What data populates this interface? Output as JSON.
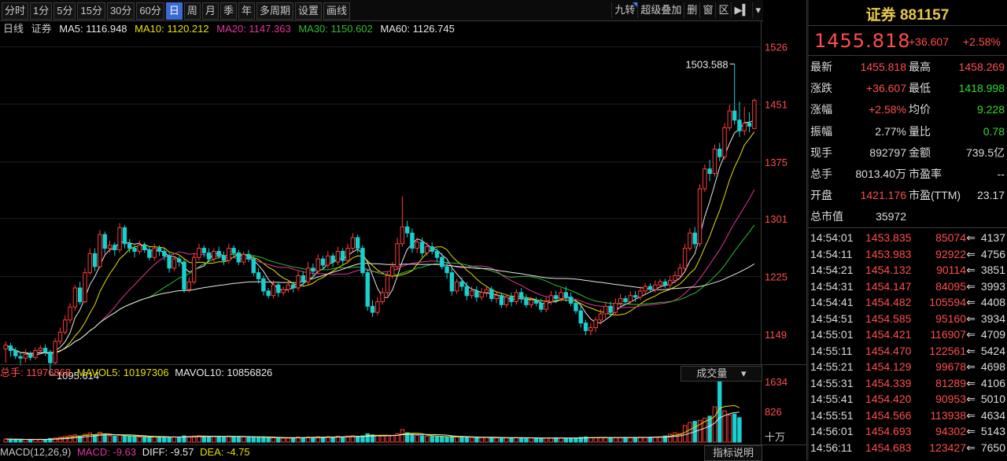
{
  "toolbar": {
    "tabs": [
      "分时",
      "1分",
      "5分",
      "15分",
      "30分",
      "60分",
      "日",
      "周",
      "月",
      "季",
      "年",
      "多周期",
      "设置",
      "画线"
    ],
    "active_tab": "日",
    "right_tools": [
      "九转",
      "超级叠加",
      "删",
      "窗",
      "区"
    ],
    "more_icon": "triangle-down",
    "arrow_icon": "arrow-right-bar"
  },
  "ma_line": {
    "period": "日线",
    "name": "证券",
    "ma5": "MA5: 1116.948",
    "ma10": "MA10: 1120.212",
    "ma20": "MA20: 1147.363",
    "ma30": "MA30: 1150.602",
    "ma60": "MA60: 1126.745"
  },
  "colors": {
    "up": "#ff3b3b",
    "down": "#18d0d0",
    "ma5": "#e8e8e8",
    "ma10": "#e8e000",
    "ma20": "#e0359a",
    "ma30": "#2fbd2f",
    "ma60": "#e8e8e8"
  },
  "price_axis": {
    "labels": [
      "1526",
      "1451",
      "1375",
      "1301",
      "1225",
      "1149"
    ]
  },
  "annotations": {
    "high": "1503.588",
    "low": "1095.614"
  },
  "volume": {
    "total": "总手: 11976868",
    "mavol5": "MAVOL5: 10197306",
    "mavol10": "MAVOL10: 10856826",
    "select": "成交量",
    "axis_labels": [
      "1634",
      "826",
      "十万"
    ]
  },
  "macd": {
    "label": "MACD(12,26,9)",
    "macd": "MACD: -9.63",
    "diff": "DIFF: -9.57",
    "dea": "DEA: -4.75",
    "indicator_button": "指标说明"
  },
  "panel": {
    "title": "证券 881157",
    "price": "1455.818",
    "change": "+36.607",
    "change_pct": "+2.58%",
    "rows": [
      {
        "l1": "最新",
        "v1": "1455.818",
        "c1": "red",
        "l2": "最高",
        "v2": "1458.269",
        "c2": "red"
      },
      {
        "l1": "涨跌",
        "v1": "+36.607",
        "c1": "red",
        "l2": "最低",
        "v2": "1418.998",
        "c2": "green"
      },
      {
        "l1": "涨幅",
        "v1": "+2.58%",
        "c1": "red",
        "l2": "均价",
        "v2": "9.228",
        "c2": "green"
      },
      {
        "l1": "振幅",
        "v1": "2.77%",
        "c1": "white",
        "l2": "量比",
        "v2": "0.78",
        "c2": "green"
      },
      {
        "l1": "现手",
        "v1": "892797",
        "c1": "white",
        "l2": "金额",
        "v2": "739.5亿",
        "c2": "white"
      },
      {
        "l1": "总手",
        "v1": "8013.40万",
        "c1": "white",
        "l2": "市盈率",
        "v2": "--",
        "c2": "white"
      },
      {
        "l1": "开盘",
        "v1": "1421.176",
        "c1": "red",
        "l2": "市盈(TTM)",
        "v2": "23.17",
        "c2": "white"
      },
      {
        "l1": "总市值",
        "v1": "35972",
        "c1": "white",
        "l2": "",
        "v2": "",
        "c2": "white"
      }
    ],
    "ticks": [
      {
        "time": "14:54:01",
        "price": "1453.835",
        "vol": "85074",
        "amt": "4137"
      },
      {
        "time": "14:54:11",
        "price": "1453.983",
        "vol": "92922",
        "amt": "4756"
      },
      {
        "time": "14:54:21",
        "price": "1454.132",
        "vol": "90114",
        "amt": "3851"
      },
      {
        "time": "14:54:31",
        "price": "1454.147",
        "vol": "84095",
        "amt": "3993"
      },
      {
        "time": "14:54:41",
        "price": "1454.482",
        "vol": "105594",
        "amt": "4408"
      },
      {
        "time": "14:54:51",
        "price": "1454.585",
        "vol": "95160",
        "amt": "3934"
      },
      {
        "time": "14:55:01",
        "price": "1454.421",
        "vol": "116907",
        "amt": "4709"
      },
      {
        "time": "14:55:11",
        "price": "1454.470",
        "vol": "122561",
        "amt": "5424"
      },
      {
        "time": "14:55:21",
        "price": "1454.129",
        "vol": "99678",
        "amt": "4698"
      },
      {
        "time": "14:55:31",
        "price": "1454.339",
        "vol": "81289",
        "amt": "4106"
      },
      {
        "time": "14:55:41",
        "price": "1454.420",
        "vol": "90953",
        "amt": "5010"
      },
      {
        "time": "14:55:51",
        "price": "1454.566",
        "vol": "113938",
        "amt": "4634"
      },
      {
        "time": "14:56:01",
        "price": "1454.693",
        "vol": "94302",
        "amt": "5143"
      },
      {
        "time": "14:56:11",
        "price": "1454.683",
        "vol": "123427",
        "amt": "7650"
      }
    ]
  },
  "chart_data": {
    "type": "candlestick",
    "y_range": [
      1110,
      1540
    ],
    "candles": [
      [
        1130,
        1135,
        1112,
        1140
      ],
      [
        1134,
        1128,
        1120,
        1138
      ],
      [
        1128,
        1121,
        1117,
        1132
      ],
      [
        1120,
        1118,
        1108,
        1126
      ],
      [
        1118,
        1123,
        1112,
        1130
      ],
      [
        1123,
        1119,
        1115,
        1127
      ],
      [
        1119,
        1128,
        1116,
        1132
      ],
      [
        1128,
        1131,
        1124,
        1135
      ],
      [
        1131,
        1126,
        1121,
        1136
      ],
      [
        1126,
        1112,
        1095.614,
        1129
      ],
      [
        1112,
        1140,
        1110,
        1144
      ],
      [
        1140,
        1152,
        1136,
        1158
      ],
      [
        1152,
        1168,
        1149,
        1174
      ],
      [
        1168,
        1185,
        1164,
        1190
      ],
      [
        1185,
        1210,
        1180,
        1214
      ],
      [
        1210,
        1192,
        1188,
        1218
      ],
      [
        1192,
        1230,
        1190,
        1236
      ],
      [
        1230,
        1255,
        1227,
        1262
      ],
      [
        1255,
        1238,
        1232,
        1262
      ],
      [
        1238,
        1280,
        1236,
        1286
      ],
      [
        1280,
        1262,
        1255,
        1284
      ],
      [
        1262,
        1266,
        1256,
        1272
      ],
      [
        1266,
        1260,
        1252,
        1270
      ],
      [
        1260,
        1289,
        1256,
        1295
      ],
      [
        1289,
        1268,
        1262,
        1292
      ],
      [
        1268,
        1262,
        1256,
        1274
      ],
      [
        1262,
        1258,
        1250,
        1266
      ],
      [
        1258,
        1266,
        1254,
        1272
      ],
      [
        1266,
        1260,
        1256,
        1270
      ],
      [
        1260,
        1250,
        1246,
        1264
      ],
      [
        1250,
        1262,
        1246,
        1268
      ],
      [
        1262,
        1258,
        1252,
        1266
      ],
      [
        1258,
        1252,
        1246,
        1262
      ],
      [
        1252,
        1236,
        1230,
        1256
      ],
      [
        1236,
        1248,
        1232,
        1252
      ],
      [
        1248,
        1244,
        1238,
        1252
      ],
      [
        1244,
        1208,
        1204,
        1248
      ],
      [
        1208,
        1218,
        1204,
        1224
      ],
      [
        1218,
        1250,
        1215,
        1256
      ],
      [
        1250,
        1262,
        1246,
        1268
      ],
      [
        1262,
        1256,
        1250,
        1266
      ],
      [
        1256,
        1248,
        1244,
        1262
      ],
      [
        1248,
        1258,
        1244,
        1262
      ],
      [
        1258,
        1252,
        1248,
        1264
      ],
      [
        1252,
        1246,
        1240,
        1258
      ],
      [
        1246,
        1262,
        1242,
        1268
      ],
      [
        1262,
        1256,
        1250,
        1266
      ],
      [
        1256,
        1244,
        1240,
        1260
      ],
      [
        1244,
        1254,
        1240,
        1258
      ],
      [
        1254,
        1248,
        1244,
        1260
      ],
      [
        1248,
        1230,
        1226,
        1252
      ],
      [
        1230,
        1222,
        1216,
        1236
      ],
      [
        1222,
        1206,
        1200,
        1226
      ],
      [
        1206,
        1200,
        1196,
        1210
      ],
      [
        1200,
        1214,
        1196,
        1220
      ],
      [
        1214,
        1204,
        1198,
        1218
      ],
      [
        1204,
        1208,
        1200,
        1212
      ],
      [
        1208,
        1214,
        1204,
        1220
      ],
      [
        1214,
        1210,
        1204,
        1218
      ],
      [
        1210,
        1226,
        1206,
        1232
      ],
      [
        1226,
        1218,
        1212,
        1232
      ],
      [
        1218,
        1236,
        1214,
        1244
      ],
      [
        1236,
        1232,
        1226,
        1242
      ],
      [
        1232,
        1248,
        1228,
        1254
      ],
      [
        1248,
        1240,
        1234,
        1252
      ],
      [
        1240,
        1252,
        1236,
        1258
      ],
      [
        1252,
        1244,
        1238,
        1256
      ],
      [
        1244,
        1258,
        1240,
        1264
      ],
      [
        1258,
        1246,
        1240,
        1262
      ],
      [
        1246,
        1262,
        1242,
        1268
      ],
      [
        1262,
        1276,
        1258,
        1282
      ],
      [
        1276,
        1262,
        1256,
        1280
      ],
      [
        1262,
        1230,
        1226,
        1266
      ],
      [
        1230,
        1186,
        1180,
        1234
      ],
      [
        1186,
        1178,
        1172,
        1194
      ],
      [
        1178,
        1192,
        1174,
        1198
      ],
      [
        1192,
        1204,
        1188,
        1210
      ],
      [
        1204,
        1226,
        1200,
        1232
      ],
      [
        1226,
        1238,
        1222,
        1244
      ],
      [
        1238,
        1268,
        1234,
        1276
      ],
      [
        1268,
        1290,
        1264,
        1330
      ],
      [
        1290,
        1282,
        1276,
        1298
      ],
      [
        1282,
        1262,
        1256,
        1288
      ],
      [
        1262,
        1270,
        1256,
        1276
      ],
      [
        1270,
        1256,
        1250,
        1276
      ],
      [
        1256,
        1264,
        1252,
        1270
      ],
      [
        1264,
        1258,
        1254,
        1270
      ],
      [
        1258,
        1250,
        1244,
        1262
      ],
      [
        1250,
        1238,
        1234,
        1256
      ],
      [
        1238,
        1230,
        1222,
        1244
      ],
      [
        1230,
        1206,
        1200,
        1236
      ],
      [
        1206,
        1218,
        1202,
        1222
      ],
      [
        1218,
        1212,
        1206,
        1224
      ],
      [
        1212,
        1200,
        1194,
        1218
      ],
      [
        1200,
        1206,
        1196,
        1212
      ],
      [
        1206,
        1198,
        1192,
        1212
      ],
      [
        1198,
        1204,
        1194,
        1210
      ],
      [
        1204,
        1208,
        1198,
        1212
      ],
      [
        1208,
        1196,
        1192,
        1212
      ],
      [
        1196,
        1200,
        1190,
        1204
      ],
      [
        1200,
        1188,
        1184,
        1204
      ],
      [
        1188,
        1198,
        1184,
        1202
      ],
      [
        1198,
        1192,
        1186,
        1204
      ],
      [
        1192,
        1204,
        1188,
        1208
      ],
      [
        1204,
        1196,
        1190,
        1210
      ],
      [
        1196,
        1188,
        1184,
        1202
      ],
      [
        1188,
        1194,
        1184,
        1198
      ],
      [
        1194,
        1190,
        1186,
        1198
      ],
      [
        1190,
        1182,
        1178,
        1196
      ],
      [
        1182,
        1192,
        1178,
        1198
      ],
      [
        1192,
        1200,
        1188,
        1206
      ],
      [
        1200,
        1196,
        1190,
        1206
      ],
      [
        1196,
        1204,
        1192,
        1210
      ],
      [
        1204,
        1198,
        1192,
        1212
      ],
      [
        1198,
        1190,
        1186,
        1204
      ],
      [
        1190,
        1180,
        1176,
        1194
      ],
      [
        1180,
        1164,
        1158,
        1186
      ],
      [
        1164,
        1154,
        1148,
        1168
      ],
      [
        1154,
        1158,
        1148,
        1164
      ],
      [
        1158,
        1168,
        1152,
        1172
      ],
      [
        1168,
        1176,
        1162,
        1182
      ],
      [
        1176,
        1186,
        1170,
        1192
      ],
      [
        1186,
        1178,
        1172,
        1192
      ],
      [
        1178,
        1190,
        1174,
        1196
      ],
      [
        1190,
        1196,
        1186,
        1202
      ],
      [
        1196,
        1192,
        1188,
        1200
      ],
      [
        1192,
        1200,
        1188,
        1206
      ],
      [
        1200,
        1198,
        1192,
        1206
      ],
      [
        1198,
        1206,
        1194,
        1212
      ],
      [
        1206,
        1212,
        1202,
        1216
      ],
      [
        1212,
        1208,
        1204,
        1216
      ],
      [
        1208,
        1214,
        1204,
        1220
      ],
      [
        1214,
        1218,
        1210,
        1222
      ],
      [
        1218,
        1214,
        1210,
        1222
      ],
      [
        1214,
        1220,
        1210,
        1226
      ],
      [
        1220,
        1226,
        1216,
        1232
      ],
      [
        1226,
        1236,
        1222,
        1242
      ],
      [
        1236,
        1262,
        1232,
        1268
      ],
      [
        1262,
        1282,
        1258,
        1288
      ],
      [
        1282,
        1268,
        1262,
        1290
      ],
      [
        1268,
        1340,
        1264,
        1346
      ],
      [
        1340,
        1366,
        1336,
        1372
      ],
      [
        1366,
        1360,
        1350,
        1378
      ],
      [
        1360,
        1392,
        1356,
        1398
      ],
      [
        1392,
        1382,
        1376,
        1400
      ],
      [
        1382,
        1420,
        1378,
        1426
      ],
      [
        1420,
        1442,
        1416,
        1450
      ],
      [
        1442,
        1430,
        1424,
        1503.588
      ],
      [
        1430,
        1416,
        1408,
        1454
      ],
      [
        1416,
        1426,
        1410,
        1448
      ],
      [
        1426,
        1422,
        1414,
        1440
      ],
      [
        1419,
        1455.818,
        1418.998,
        1458.269
      ]
    ],
    "volume": [
      30,
      28,
      26,
      24,
      26,
      25,
      27,
      28,
      26,
      35,
      40,
      48,
      55,
      62,
      70,
      58,
      75,
      88,
      72,
      95,
      70,
      60,
      58,
      66,
      60,
      55,
      52,
      50,
      48,
      46,
      50,
      52,
      48,
      46,
      50,
      48,
      60,
      55,
      58,
      62,
      56,
      54,
      52,
      56,
      50,
      58,
      54,
      52,
      50,
      48,
      46,
      48,
      44,
      40,
      42,
      40,
      38,
      40,
      42,
      48,
      44,
      50,
      46,
      52,
      48,
      52,
      48,
      56,
      50,
      58,
      62,
      55,
      60,
      80,
      70,
      62,
      58,
      60,
      66,
      80,
      120,
      90,
      70,
      66,
      62,
      58,
      56,
      52,
      50,
      48,
      56,
      50,
      48,
      46,
      44,
      42,
      44,
      46,
      42,
      40,
      42,
      40,
      42,
      44,
      42,
      40,
      40,
      38,
      36,
      38,
      40,
      42,
      40,
      38,
      36,
      40,
      46,
      50,
      44,
      42,
      44,
      46,
      44,
      42,
      44,
      46,
      44,
      46,
      48,
      46,
      48,
      50,
      52,
      60,
      76,
      90,
      82,
      160,
      190,
      200,
      210,
      230,
      250,
      340,
      590,
      300,
      260,
      270,
      235
    ]
  }
}
